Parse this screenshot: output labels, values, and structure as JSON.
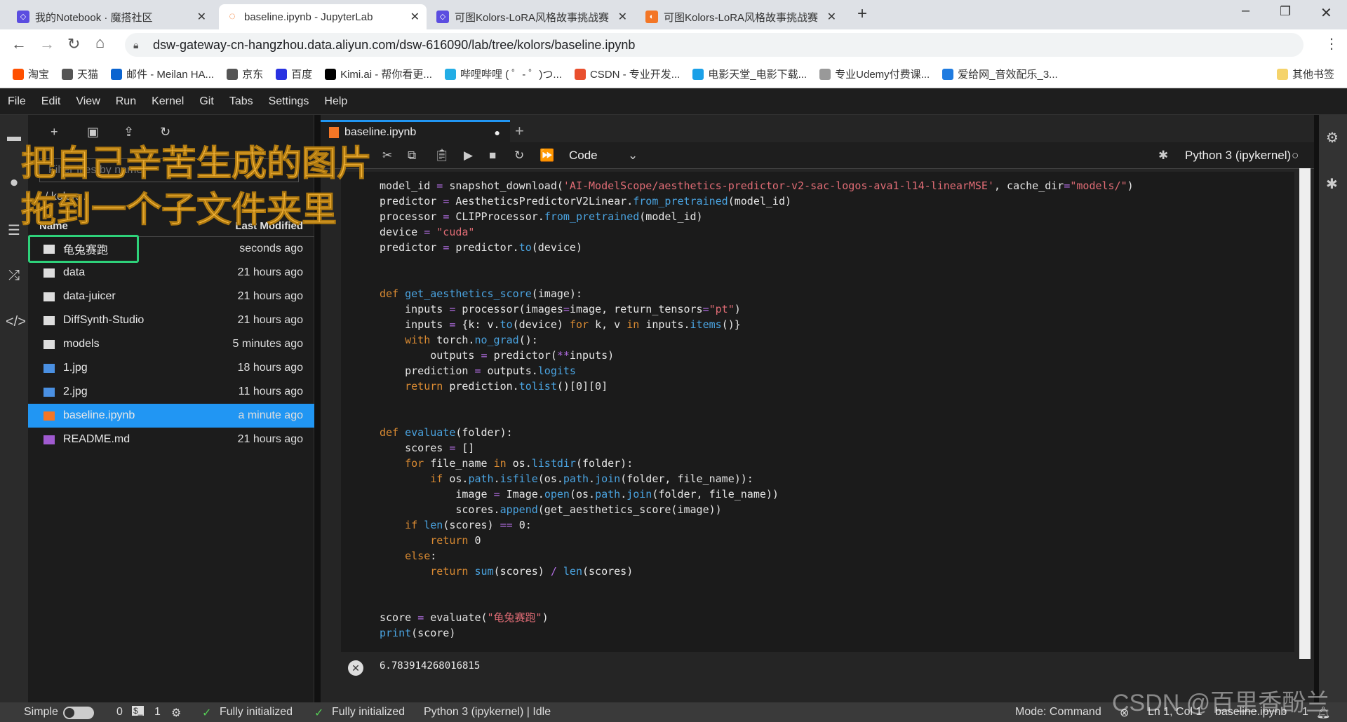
{
  "browser": {
    "tabs": [
      {
        "label": "我的Notebook · 魔搭社区",
        "active": false
      },
      {
        "label": "baseline.ipynb - JupyterLab",
        "active": true
      },
      {
        "label": "可图Kolors-LoRA风格故事挑战赛",
        "active": false
      },
      {
        "label": "可图Kolors-LoRA风格故事挑战赛",
        "active": false
      }
    ],
    "url": "dsw-gateway-cn-hangzhou.data.aliyun.com/dsw-616090/lab/tree/kolors/baseline.ipynb",
    "bookmarks": [
      {
        "label": "淘宝",
        "color": "#ff5000"
      },
      {
        "label": "天猫",
        "color": "#555"
      },
      {
        "label": "邮件 - Meilan HA...",
        "color": "#0a64d0"
      },
      {
        "label": "京东",
        "color": "#555"
      },
      {
        "label": "百度",
        "color": "#2932e1"
      },
      {
        "label": "Kimi.ai - 帮你看更...",
        "color": "#000"
      },
      {
        "label": "哔哩哔哩 ( ゜- ゜)つ...",
        "color": "#23ade5"
      },
      {
        "label": "CSDN - 专业开发...",
        "color": "#e94f2e"
      },
      {
        "label": "电影天堂_电影下载...",
        "color": "#1aa0e8"
      },
      {
        "label": "专业Udemy付费课...",
        "color": "#999"
      },
      {
        "label": "爱给网_音效配乐_3...",
        "color": "#1f7be0"
      }
    ],
    "other_bookmarks": "其他书签"
  },
  "menu": [
    "File",
    "Edit",
    "View",
    "Run",
    "Kernel",
    "Git",
    "Tabs",
    "Settings",
    "Help"
  ],
  "filebrowser": {
    "filter_placeholder": "Filter files by name",
    "breadcrumb": "/ kolors /",
    "col_name": "Name",
    "col_modified": "Last Modified",
    "rows": [
      {
        "name": "龟兔赛跑",
        "type": "folder",
        "modified": "seconds ago"
      },
      {
        "name": "data",
        "type": "folder",
        "modified": "21 hours ago"
      },
      {
        "name": "data-juicer",
        "type": "folder",
        "modified": "21 hours ago"
      },
      {
        "name": "DiffSynth-Studio",
        "type": "folder",
        "modified": "21 hours ago"
      },
      {
        "name": "models",
        "type": "folder",
        "modified": "5 minutes ago"
      },
      {
        "name": "1.jpg",
        "type": "image",
        "modified": "18 hours ago"
      },
      {
        "name": "2.jpg",
        "type": "image",
        "modified": "11 hours ago"
      },
      {
        "name": "baseline.ipynb",
        "type": "notebook",
        "modified": "a minute ago",
        "selected": true
      },
      {
        "name": "README.md",
        "type": "markdown",
        "modified": "21 hours ago"
      }
    ]
  },
  "notebook": {
    "tab": "baseline.ipynb",
    "cell_type": "Code",
    "kernel": "Python 3 (ipykernel)",
    "code": [
      [
        [
          "model_id ",
          ""
        ],
        [
          "= ",
          "op"
        ],
        [
          "snapshot_download(",
          ""
        ],
        [
          "'AI-ModelScope/aesthetics-predictor-v2-sac-logos-ava1-l14-linearMSE'",
          "st"
        ],
        [
          ", cache_dir",
          ""
        ],
        [
          "=",
          "op"
        ],
        [
          "\"models/\"",
          "st"
        ],
        [
          ")",
          ""
        ]
      ],
      [
        [
          "predictor ",
          ""
        ],
        [
          "= ",
          "op"
        ],
        [
          "AestheticsPredictorV2Linear.",
          ""
        ],
        [
          "from_pretrained",
          "fn"
        ],
        [
          "(model_id)",
          ""
        ]
      ],
      [
        [
          "processor ",
          ""
        ],
        [
          "= ",
          "op"
        ],
        [
          "CLIPProcessor.",
          ""
        ],
        [
          "from_pretrained",
          "fn"
        ],
        [
          "(model_id)",
          ""
        ]
      ],
      [
        [
          "device ",
          ""
        ],
        [
          "= ",
          "op"
        ],
        [
          "\"cuda\"",
          "st"
        ]
      ],
      [
        [
          "predictor ",
          ""
        ],
        [
          "= ",
          "op"
        ],
        [
          "predictor.",
          ""
        ],
        [
          "to",
          "fn"
        ],
        [
          "(device)",
          ""
        ]
      ],
      [],
      [],
      [
        [
          "def ",
          "kw"
        ],
        [
          "get_aesthetics_score",
          "fn"
        ],
        [
          "(image):",
          ""
        ]
      ],
      [
        [
          "    inputs ",
          ""
        ],
        [
          "= ",
          "op"
        ],
        [
          "processor(images",
          ""
        ],
        [
          "=",
          "op"
        ],
        [
          "image, return_tensors",
          ""
        ],
        [
          "=",
          "op"
        ],
        [
          "\"pt\"",
          "st"
        ],
        [
          ")",
          ""
        ]
      ],
      [
        [
          "    inputs ",
          ""
        ],
        [
          "= ",
          "op"
        ],
        [
          "{k: v.",
          ""
        ],
        [
          "to",
          "fn"
        ],
        [
          "(device) ",
          ""
        ],
        [
          "for ",
          "kw"
        ],
        [
          "k, v ",
          ""
        ],
        [
          "in ",
          "kw"
        ],
        [
          "inputs.",
          ""
        ],
        [
          "items",
          "fn"
        ],
        [
          "()}",
          ""
        ]
      ],
      [
        [
          "    ",
          ""
        ],
        [
          "with ",
          "kw"
        ],
        [
          "torch.",
          ""
        ],
        [
          "no_grad",
          "fn"
        ],
        [
          "():",
          ""
        ]
      ],
      [
        [
          "        outputs ",
          ""
        ],
        [
          "= ",
          "op"
        ],
        [
          "predictor(",
          ""
        ],
        [
          "**",
          "op"
        ],
        [
          "inputs)",
          ""
        ]
      ],
      [
        [
          "    prediction ",
          ""
        ],
        [
          "= ",
          "op"
        ],
        [
          "outputs.",
          ""
        ],
        [
          "logits",
          "fn"
        ]
      ],
      [
        [
          "    ",
          ""
        ],
        [
          "return ",
          "kw"
        ],
        [
          "prediction.",
          ""
        ],
        [
          "tolist",
          "fn"
        ],
        [
          "()[0][0]",
          ""
        ]
      ],
      [],
      [],
      [
        [
          "def ",
          "kw"
        ],
        [
          "evaluate",
          "fn"
        ],
        [
          "(folder):",
          ""
        ]
      ],
      [
        [
          "    scores ",
          ""
        ],
        [
          "= ",
          "op"
        ],
        [
          "[]",
          ""
        ]
      ],
      [
        [
          "    ",
          ""
        ],
        [
          "for ",
          "kw"
        ],
        [
          "file_name ",
          ""
        ],
        [
          "in ",
          "kw"
        ],
        [
          "os.",
          ""
        ],
        [
          "listdir",
          "fn"
        ],
        [
          "(folder):",
          ""
        ]
      ],
      [
        [
          "        ",
          ""
        ],
        [
          "if ",
          "kw"
        ],
        [
          "os.",
          ""
        ],
        [
          "path",
          "fn"
        ],
        [
          ".",
          ""
        ],
        [
          "isfile",
          "fn"
        ],
        [
          "(os.",
          ""
        ],
        [
          "path",
          "fn"
        ],
        [
          ".",
          ""
        ],
        [
          "join",
          "fn"
        ],
        [
          "(folder, file_name)):",
          ""
        ]
      ],
      [
        [
          "            image ",
          ""
        ],
        [
          "= ",
          "op"
        ],
        [
          "Image.",
          ""
        ],
        [
          "open",
          "fn"
        ],
        [
          "(os.",
          ""
        ],
        [
          "path",
          "fn"
        ],
        [
          ".",
          ""
        ],
        [
          "join",
          "fn"
        ],
        [
          "(folder, file_name))",
          ""
        ]
      ],
      [
        [
          "            scores.",
          ""
        ],
        [
          "append",
          "fn"
        ],
        [
          "(get_aesthetics_score(image))",
          ""
        ]
      ],
      [
        [
          "    ",
          ""
        ],
        [
          "if ",
          "kw"
        ],
        [
          "len",
          "fn"
        ],
        [
          "(scores) ",
          ""
        ],
        [
          "== ",
          "op"
        ],
        [
          "0:",
          ""
        ]
      ],
      [
        [
          "        ",
          ""
        ],
        [
          "return ",
          "kw"
        ],
        [
          "0",
          ""
        ]
      ],
      [
        [
          "    ",
          ""
        ],
        [
          "else",
          "kw"
        ],
        [
          ":",
          ""
        ]
      ],
      [
        [
          "        ",
          ""
        ],
        [
          "return ",
          "kw"
        ],
        [
          "sum",
          "fn"
        ],
        [
          "(scores) ",
          ""
        ],
        [
          "/ ",
          "op"
        ],
        [
          "len",
          "fn"
        ],
        [
          "(scores)",
          ""
        ]
      ],
      [],
      [],
      [
        [
          "score ",
          ""
        ],
        [
          "= ",
          "op"
        ],
        [
          "evaluate(",
          ""
        ],
        [
          "\"龟兔赛跑\"",
          "st"
        ],
        [
          ")",
          ""
        ]
      ],
      [
        [
          "print",
          "fn"
        ],
        [
          "(score)",
          ""
        ]
      ]
    ],
    "output": "6.783914268016815"
  },
  "status": {
    "mode_label": "Simple",
    "terminals": "0",
    "kernels": "1",
    "init1": "Fully initialized",
    "init2": "Fully initialized",
    "kernel_status": "Python 3 (ipykernel) | Idle",
    "mode": "Mode: Command",
    "cursor": "Ln 1, Col 1",
    "file": "baseline.ipynb",
    "notifications": "1"
  },
  "overlay": {
    "line1": "把自己辛苦生成的图片",
    "line2": "拖到一个子文件夹里"
  },
  "watermark": "CSDN @百里香酚兰"
}
